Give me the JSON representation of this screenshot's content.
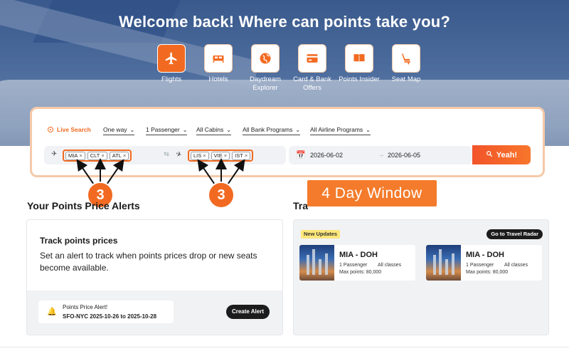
{
  "hero": {
    "title": "Welcome back! Where can points take you?"
  },
  "nav": {
    "items": [
      {
        "label": "Flights",
        "icon": "plane-icon",
        "active": true
      },
      {
        "label": "Hotels",
        "icon": "bed-icon",
        "active": false
      },
      {
        "label": "Daydream Explorer",
        "icon": "globe-icon",
        "active": false
      },
      {
        "label": "Card & Bank Offers",
        "icon": "credit-card-icon",
        "active": false
      },
      {
        "label": "Points Insider",
        "icon": "book-icon",
        "active": false
      },
      {
        "label": "Seat Map",
        "icon": "seat-icon",
        "active": false
      }
    ]
  },
  "search": {
    "live_label": "Live Search",
    "trip_type": "One way",
    "passengers": "1 Passenger",
    "cabins": "All Cabins",
    "bank_programs": "All Bank Programs",
    "airline_programs": "All Airline Programs",
    "origins": [
      "MIA",
      "CLT",
      "ATL"
    ],
    "destinations": [
      "LIS",
      "VIE",
      "IST"
    ],
    "date_start": "2026-06-02",
    "date_end": "2026-06-05",
    "submit_label": "Yeah!"
  },
  "annotations": {
    "origin_count": "3",
    "destination_count": "3",
    "window_label": "4 Day Window"
  },
  "alerts": {
    "section_title": "Your Points Price Alerts",
    "card_title": "Track points prices",
    "card_desc": "Set an alert to track when points prices drop or new seats become available.",
    "alert_title": "Points Price Alert!",
    "alert_route": "SFO-NYC 2025-10-26 to 2025-10-28",
    "create_label": "Create Alert"
  },
  "radar": {
    "section_title": "Tra",
    "new_tag": "New Updates",
    "go_label": "Go to Travel Radar",
    "deals": [
      {
        "route": "MIA - DOH",
        "pax": "1 Passenger",
        "cabin": "All classes",
        "points": "Max points: 80,000"
      },
      {
        "route": "MIA - DOH",
        "pax": "1 Passenger",
        "cabin": "All classes",
        "points": "Max points: 80,000"
      }
    ]
  },
  "colors": {
    "accent": "#f26a21",
    "hero": "#4b6a9e",
    "dark": "#1c1c1c"
  }
}
